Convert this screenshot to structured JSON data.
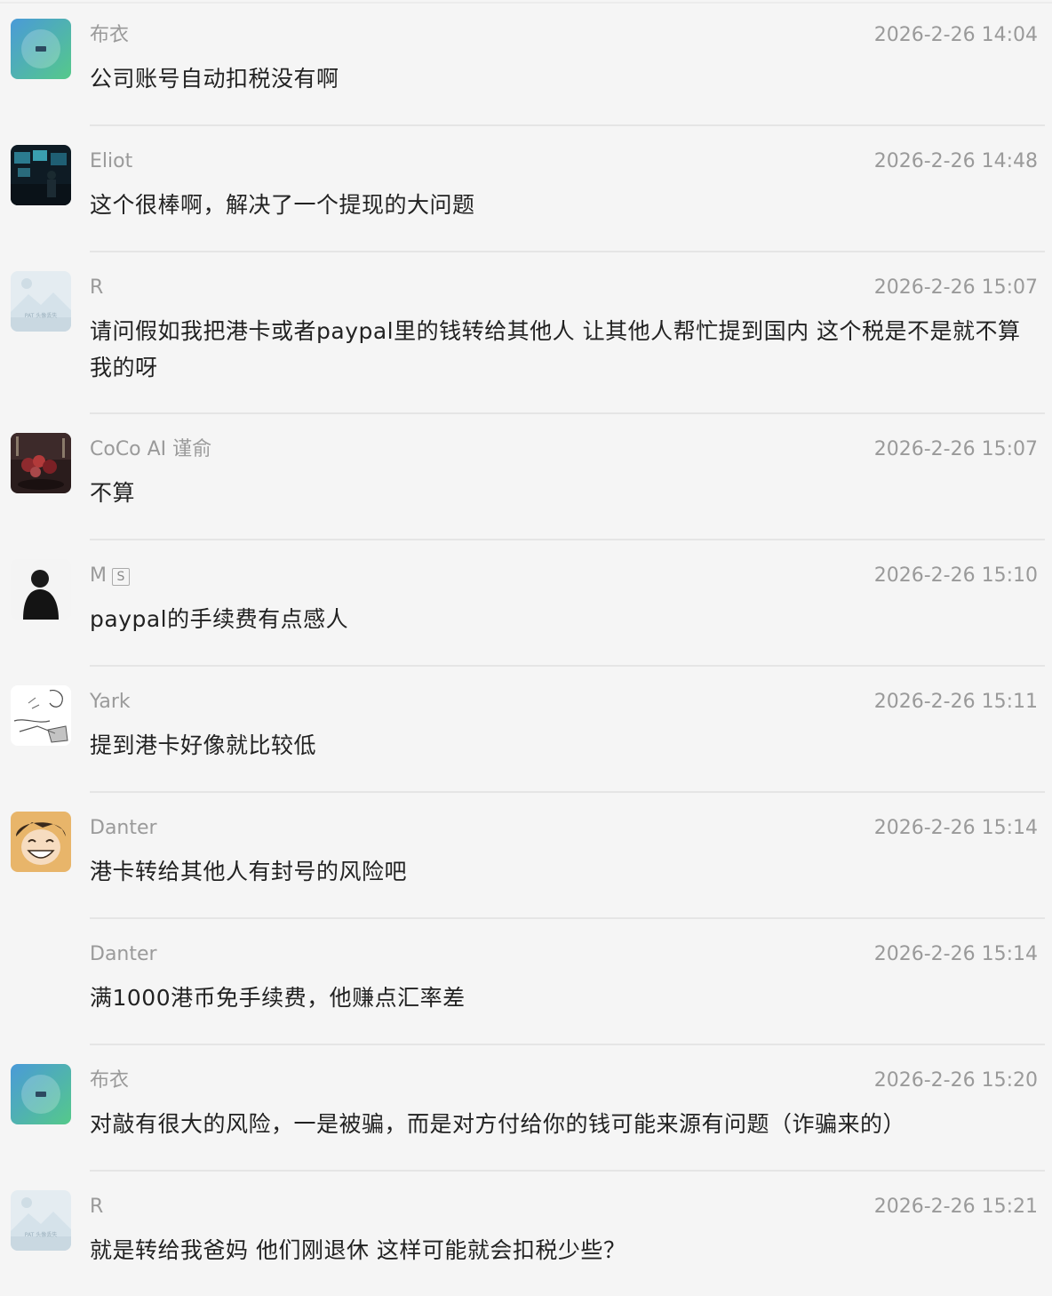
{
  "messages": [
    {
      "name": "布衣",
      "time": "2026-2-26 14:04",
      "text": "公司账号自动扣税没有啊",
      "avatar": "green-gradient-avatar"
    },
    {
      "name": "Eliot",
      "time": "2026-2-26 14:48",
      "text": "这个很棒啊，解决了一个提现的大问题",
      "avatar": "dark-office-photo-avatar"
    },
    {
      "name": "R",
      "time": "2026-2-26 15:07",
      "text": "请问假如我把港卡或者paypal里的钱转给其他人  让其他人帮忙提到国内   这个税是不是就不算我的呀",
      "avatar": "placeholder-image-avatar",
      "avatar_caption": "PAT 头像丢失"
    },
    {
      "name": "CoCo AI 谨俞",
      "time": "2026-2-26 15:07",
      "text": "不算",
      "avatar": "flowers-photo-avatar"
    },
    {
      "name": "M",
      "badge": "S",
      "time": "2026-2-26 15:10",
      "text": "paypal的手续费有点感人",
      "avatar": "silhouette-avatar"
    },
    {
      "name": "Yark",
      "time": "2026-2-26 15:11",
      "text": "提到港卡好像就比较低",
      "avatar": "sketch-avatar"
    },
    {
      "name": "Danter",
      "time": "2026-2-26 15:14",
      "text": "港卡转给其他人有封号的风险吧",
      "avatar": "cartoon-smile-avatar"
    },
    {
      "name": "Danter",
      "time": "2026-2-26 15:14",
      "text": "满1000港币免手续费，他赚点汇率差",
      "avatar": ""
    },
    {
      "name": "布衣",
      "time": "2026-2-26 15:20",
      "text": "对敲有很大的风险，一是被骗，而是对方付给你的钱可能来源有问题（诈骗来的）",
      "avatar": "green-gradient-avatar"
    },
    {
      "name": "R",
      "time": "2026-2-26 15:21",
      "text": "就是转给我爸妈  他们刚退休  这样可能就会扣税少些？",
      "avatar": "placeholder-image-avatar",
      "avatar_caption": "PAT 头像丢失"
    }
  ]
}
